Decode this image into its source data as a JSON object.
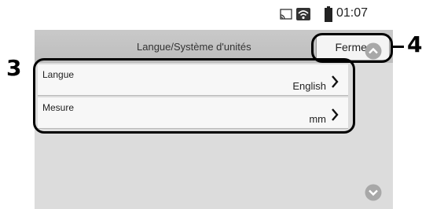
{
  "status_bar": {
    "time": "01:07"
  },
  "header": {
    "title": "Langue/Système d'unités",
    "close_label": "Fermer"
  },
  "settings_list": {
    "items": [
      {
        "label": "Langue",
        "value": "English"
      },
      {
        "label": "Mesure",
        "value": "mm"
      }
    ]
  },
  "callouts": {
    "list_group": "3",
    "close_button": "4"
  },
  "colors": {
    "screen_bg": "#dcdcdc",
    "title_bar": "#c4c4c4",
    "scroll_button": "#a8a8a8",
    "callout": "#000000"
  },
  "icons": {
    "cast": "cast-icon",
    "wifi": "wifi-icon",
    "battery": "battery-icon",
    "chevron": "chevron-right-icon",
    "scroll_up": "scroll-up-icon",
    "scroll_down": "scroll-down-icon"
  }
}
